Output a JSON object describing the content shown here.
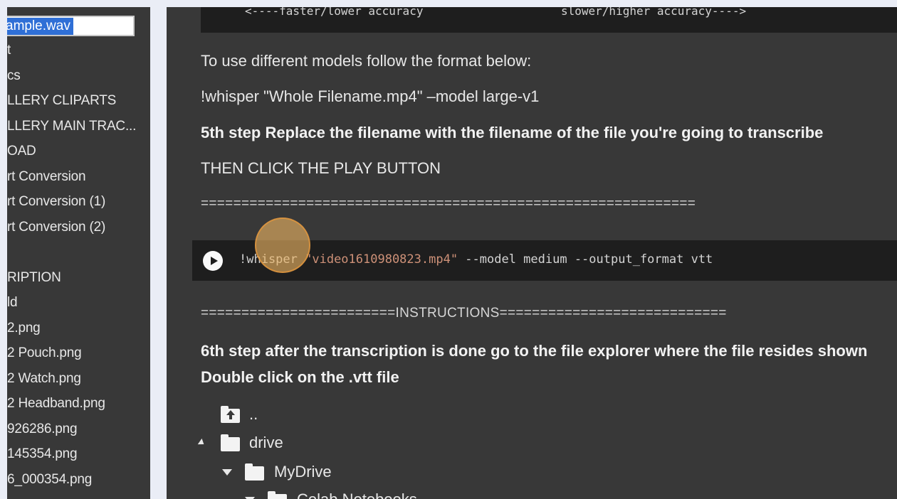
{
  "sidebar": {
    "rename_value": "ample.wav",
    "items": [
      "t",
      "cs",
      "LLERY CLIPARTS",
      "LLERY MAIN TRAC...",
      "OAD",
      "rt Conversion",
      "rt Conversion (1)",
      "rt Conversion (2)",
      "RIPTION",
      "ld",
      "2.png",
      "2 Pouch.png",
      "2 Watch.png",
      "2 Headband.png",
      "926286.png",
      "145354.png",
      "6_000354.png"
    ]
  },
  "notebook": {
    "top_code_left": "<----faster/lower accuracy",
    "top_code_right": "slower/higher accuracy---->",
    "models_heading": "To use different models follow the format below:",
    "models_example": "!whisper \"Whole Filename.mp4\" –model large-v1",
    "step5": "5th step Replace the filename with the filename of the file you're going to transcribe",
    "play_instruction": "THEN CLICK THE PLAY BUTTON",
    "separator": "=============================================================",
    "code": {
      "command": "!whisper ",
      "filename": "\"video1610980823.mp4\"",
      "args": " --model medium --output_format vtt"
    },
    "instructions_separator": "========================INSTRUCTIONS============================",
    "step6": "6th step after the transcription is done go to the file explorer where the file resides shown",
    "step6b": "Double click on the .vtt file",
    "tree": {
      "up": "..",
      "drive": "drive",
      "mydrive": "MyDrive",
      "colab": "Colab Notebooks"
    }
  },
  "colors": {
    "background": "#eaedf6",
    "panel": "#383838",
    "code_bg": "#1e1e1e",
    "string": "#ce9178",
    "selection": "#2f6fd6",
    "click_marker": "#edb462"
  }
}
